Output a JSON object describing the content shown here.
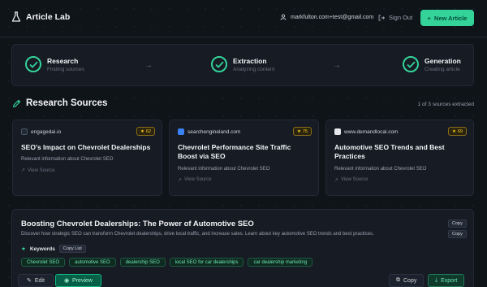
{
  "header": {
    "app_title": "Article Lab",
    "user_email": "markfulton.com+test@gmail.com",
    "sign_out": "Sign Out",
    "new_article": "New Article"
  },
  "steps": [
    {
      "title": "Research",
      "sub": "Finding sources"
    },
    {
      "title": "Extraction",
      "sub": "Analyzing content"
    },
    {
      "title": "Generation",
      "sub": "Creating article"
    }
  ],
  "research": {
    "title": "Research Sources",
    "count": "1 of 3 sources extracted",
    "cards": [
      {
        "domain": "engagedai.io",
        "score": "62",
        "title": "SEO's Impact on Chevrolet Dealerships",
        "desc": "Relevant information about Chevrolet SEO",
        "view": "View Source"
      },
      {
        "domain": "searchengineland.com",
        "score": "75",
        "title": "Chevrolet Performance Site Traffic Boost via SEO",
        "desc": "Relevant information about Chevrolet SEO",
        "view": "View Source"
      },
      {
        "domain": "www.demandlocal.com",
        "score": "69",
        "title": "Automotive SEO Trends and Best Practices",
        "desc": "Relevant information about Chevrolet SEO",
        "view": "View Source"
      }
    ]
  },
  "article": {
    "title": "Boosting Chevrolet Dealerships: The Power of Automotive SEO",
    "desc": "Discover how strategic SEO can transform Chevrolet dealerships, drive local traffic, and increase sales. Learn about key automotive SEO trends and best practices.",
    "copy": "Copy",
    "keywords_label": "Keywords",
    "copy_list": "Copy List",
    "tags": [
      "Chevrolet SEO",
      "automotive SEO",
      "dealership SEO",
      "local SEO for car dealerships",
      "car dealership marketing"
    ],
    "edit": "Edit",
    "preview": "Preview",
    "copy_btn": "Copy",
    "export": "Export"
  }
}
